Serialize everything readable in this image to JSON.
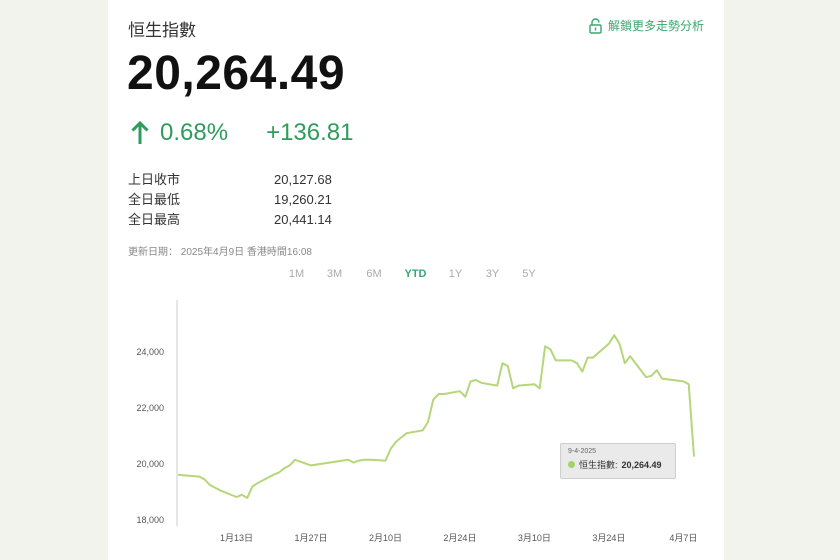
{
  "header": {
    "title": "恒生指數",
    "unlock_label": "解鎖更多走勢分析",
    "price": "20,264.49",
    "change_pct": "0.68%",
    "change_abs": "+136.81"
  },
  "stats": [
    {
      "label": "上日收市",
      "value": "20,127.68"
    },
    {
      "label": "全日最低",
      "value": "19,260.21"
    },
    {
      "label": "全日最高",
      "value": "20,441.14"
    }
  ],
  "updated": "更新日期： 2025年4月9日 香港時間16:08",
  "ranges": [
    "1M",
    "3M",
    "6M",
    "YTD",
    "1Y",
    "3Y",
    "5Y"
  ],
  "active_range": "YTD",
  "colors": {
    "accent": "#3aa66c",
    "line": "#b5d67a",
    "up": "#2e9c5c"
  },
  "tooltip": {
    "date": "9-4-2025",
    "series": "恒生指數:",
    "value": "20,264.49"
  },
  "chart_data": {
    "type": "line",
    "y_ticks": [
      "18,000",
      "20,000",
      "22,000",
      "24,000"
    ],
    "x_ticks": [
      "1月13日",
      "1月27日",
      "2月10日",
      "2月24日",
      "3月10日",
      "3月24日",
      "4月7日"
    ],
    "ylim": [
      18000,
      26000
    ],
    "grid": false,
    "series": [
      {
        "name": "恒生指數",
        "x": [
          "2025-01-02",
          "2025-01-03",
          "2025-01-06",
          "2025-01-07",
          "2025-01-08",
          "2025-01-09",
          "2025-01-10",
          "2025-01-13",
          "2025-01-14",
          "2025-01-15",
          "2025-01-16",
          "2025-01-17",
          "2025-01-20",
          "2025-01-21",
          "2025-01-22",
          "2025-01-23",
          "2025-01-24",
          "2025-01-27",
          "2025-02-03",
          "2025-02-04",
          "2025-02-05",
          "2025-02-06",
          "2025-02-07",
          "2025-02-10",
          "2025-02-11",
          "2025-02-12",
          "2025-02-13",
          "2025-02-14",
          "2025-02-17",
          "2025-02-18",
          "2025-02-19",
          "2025-02-20",
          "2025-02-21",
          "2025-02-24",
          "2025-02-25",
          "2025-02-26",
          "2025-02-27",
          "2025-02-28",
          "2025-03-03",
          "2025-03-04",
          "2025-03-05",
          "2025-03-06",
          "2025-03-07",
          "2025-03-10",
          "2025-03-11",
          "2025-03-12",
          "2025-03-13",
          "2025-03-14",
          "2025-03-17",
          "2025-03-18",
          "2025-03-19",
          "2025-03-20",
          "2025-03-21",
          "2025-03-24",
          "2025-03-25",
          "2025-03-26",
          "2025-03-27",
          "2025-03-28",
          "2025-03-31",
          "2025-04-01",
          "2025-04-02",
          "2025-04-03",
          "2025-04-07",
          "2025-04-08",
          "2025-04-09"
        ],
        "values": [
          19620,
          19600,
          19550,
          19450,
          19250,
          19150,
          19050,
          18820,
          18900,
          18790,
          19200,
          19320,
          19620,
          19700,
          19850,
          19950,
          20150,
          19950,
          20150,
          20050,
          20120,
          20150,
          20150,
          20120,
          20550,
          20800,
          20950,
          21100,
          21200,
          21500,
          22300,
          22500,
          22500,
          22600,
          22400,
          22950,
          23000,
          22900,
          22800,
          23600,
          23500,
          22700,
          22800,
          22850,
          22700,
          24200,
          24100,
          23700,
          23700,
          23600,
          23300,
          23800,
          23800,
          24300,
          24600,
          24300,
          23600,
          23850,
          23100,
          23150,
          23350,
          23050,
          22950,
          22850,
          20264
        ]
      }
    ]
  }
}
